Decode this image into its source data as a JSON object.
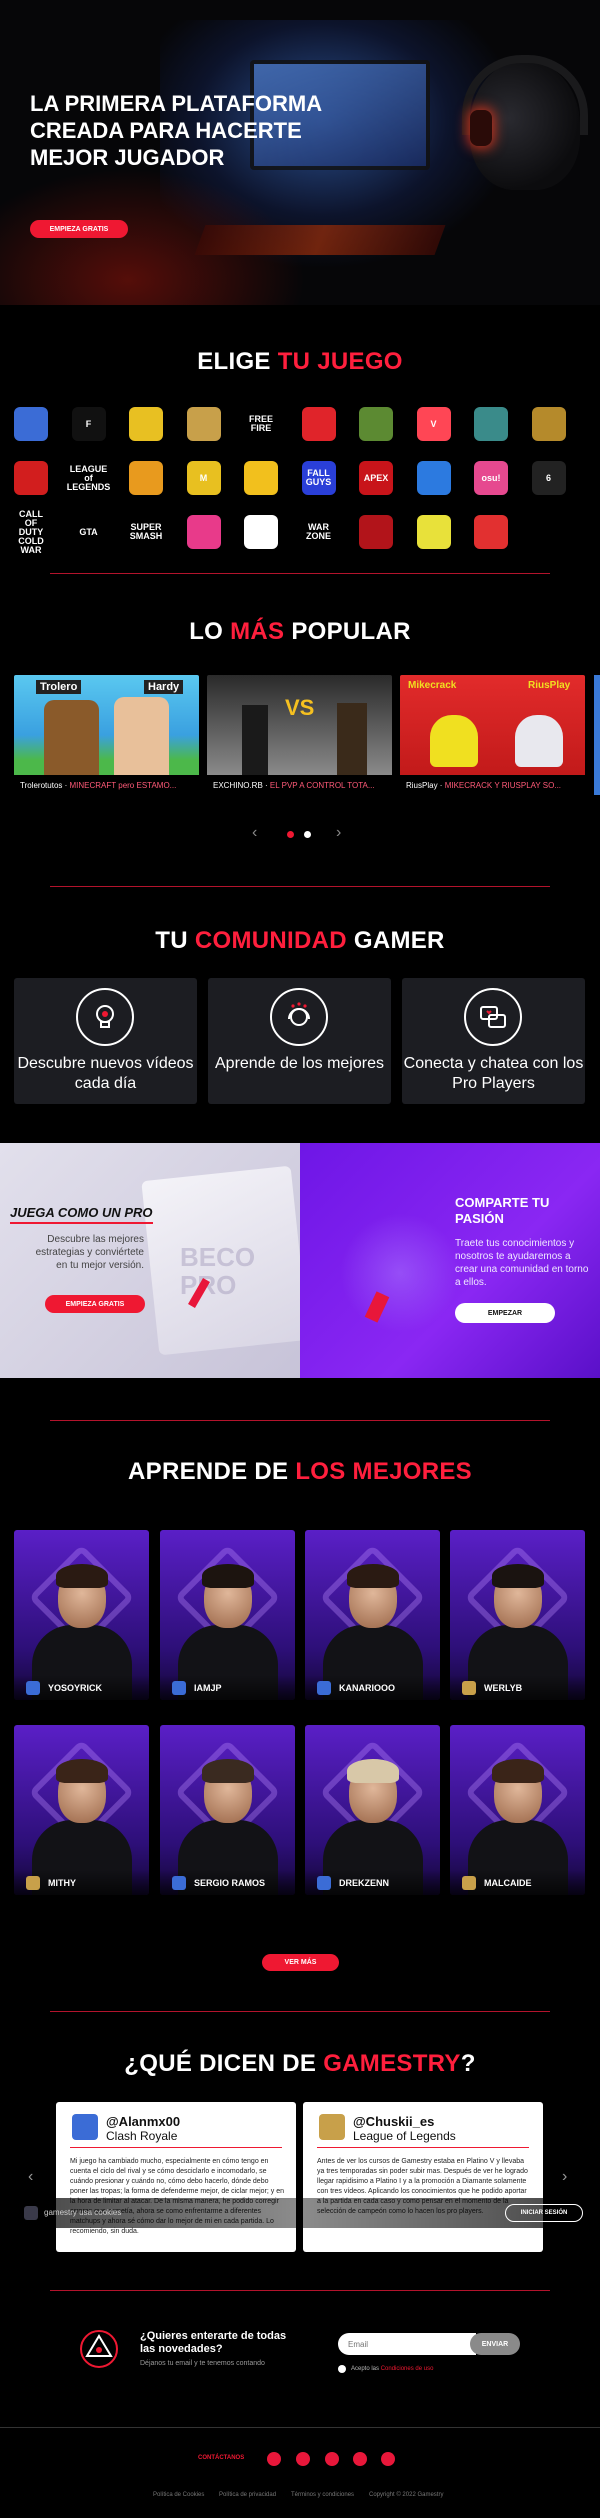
{
  "hero": {
    "title": "LA PRIMERA PLATAFORMA CREADA PARA HACERTE MEJOR JUGADOR",
    "cta": "EMPIEZA GRATIS"
  },
  "games": {
    "title_white": "ELIGE",
    "title_red": "TU JUEGO",
    "items": [
      {
        "name": "clash-royale",
        "label": "",
        "color": "#3b6cd6"
      },
      {
        "name": "fortnite",
        "label": "F",
        "color": "#111"
      },
      {
        "name": "brawl-stars",
        "label": "",
        "color": "#e8c022"
      },
      {
        "name": "league-of-legends",
        "label": "",
        "color": "#c8a04a"
      },
      {
        "name": "free-fire",
        "label": "FREE FIRE",
        "color": ""
      },
      {
        "name": "roblox",
        "label": "",
        "color": "#e0242a"
      },
      {
        "name": "minecraft",
        "label": "",
        "color": "#5c8a32"
      },
      {
        "name": "valorant",
        "label": "V",
        "color": "#ff4655"
      },
      {
        "name": "tft",
        "label": "",
        "color": "#3a8b8a"
      },
      {
        "name": "hearthstone",
        "label": "",
        "color": "#b58a2b"
      },
      {
        "name": "among-us",
        "label": "",
        "color": "#d21e1e"
      },
      {
        "name": "league-of-legends-wild-rift",
        "label": "LEAGUE of LEGENDS",
        "color": ""
      },
      {
        "name": "counter-strike",
        "label": "",
        "color": "#e89a1e"
      },
      {
        "name": "mobile-legends",
        "label": "M",
        "color": "#e8c020"
      },
      {
        "name": "tft-mobile",
        "label": "",
        "color": "#f2c01d"
      },
      {
        "name": "fall-guys",
        "label": "FALL GUYS",
        "color": "#2a3fd8"
      },
      {
        "name": "apex-legends",
        "label": "APEX",
        "color": "#c8141a"
      },
      {
        "name": "rocket-league",
        "label": "",
        "color": "#2c7ae0"
      },
      {
        "name": "osu",
        "label": "osu!",
        "color": "#e6498f"
      },
      {
        "name": "rainbow-six",
        "label": "6",
        "color": "#222"
      },
      {
        "name": "cod-cold-war",
        "label": "CALL OF DUTY COLD WAR",
        "color": ""
      },
      {
        "name": "gta",
        "label": "GTA",
        "color": ""
      },
      {
        "name": "super-smash",
        "label": "SUPER SMASH",
        "color": ""
      },
      {
        "name": "pokemon-unite",
        "label": "",
        "color": "#e83a8a"
      },
      {
        "name": "legends-runeterra",
        "label": "",
        "color": "#fff"
      },
      {
        "name": "warzone",
        "label": "WAR ZONE",
        "color": ""
      },
      {
        "name": "fifa",
        "label": "",
        "color": "#b2141a"
      },
      {
        "name": "cyberpunk",
        "label": "",
        "color": "#e8e13a"
      },
      {
        "name": "pokemon",
        "label": "",
        "color": "#e23030"
      }
    ]
  },
  "popular": {
    "title_white_1": "LO",
    "title_red": "MÁS",
    "title_white_2": "POPULAR",
    "videos": [
      {
        "channel": "Trolerotutos",
        "title": "MINECRAFT pero ESTAMO...",
        "thumb_text_1": "Trolero",
        "thumb_text_2": "Hardy"
      },
      {
        "channel": "EXCHINO.RB",
        "title": "EL PVP A CONTROL TOTA...",
        "thumb_text_1": "VS",
        "thumb_text_2": ""
      },
      {
        "channel": "RiusPlay",
        "title": "MIKECRACK Y RIUSPLAY SO...",
        "thumb_text_1": "Mikecrack",
        "thumb_text_2": "RiusPlay"
      }
    ]
  },
  "community": {
    "title_white_1": "TU",
    "title_red": "COMUNIDAD",
    "title_white_2": "GAMER",
    "cards": [
      {
        "text": "Descubre nuevos vídeos cada día",
        "icon": "lightbulb-gamepad-icon"
      },
      {
        "text": "Aprende de los mejores",
        "icon": "gamer-headset-icon"
      },
      {
        "text": "Conecta y chatea con los Pro Players",
        "icon": "chat-heart-icon"
      }
    ]
  },
  "pro_banner": {
    "title": "JUEGA COMO UN PRO",
    "text": "Descubre las mejores estrategias y conviértete en tu mejor versión.",
    "cta": "EMPIEZA GRATIS",
    "watermark": "BECO PRO"
  },
  "share_banner": {
    "title": "COMPARTE TU PASIÓN",
    "text": "Traete tus conocimientos y nosotros te ayudaremos a crear una comunidad en torno a ellos.",
    "cta": "EMPEZAR"
  },
  "pros": {
    "title_white": "APRENDE DE",
    "title_red": "LOS MEJORES",
    "players": [
      {
        "name": "YOSOYRICK",
        "game": "clash-royale",
        "hair": "#2a1a12"
      },
      {
        "name": "IAMJP",
        "game": "clash-royale",
        "hair": "#1c140f"
      },
      {
        "name": "KANARIOOO",
        "game": "clash-royale",
        "hair": "#2a1a12"
      },
      {
        "name": "WERLYB",
        "game": "league-of-legends",
        "hair": "#1a1310"
      },
      {
        "name": "MITHY",
        "game": "league-of-legends",
        "hair": "#3a2418"
      },
      {
        "name": "SERGIO RAMOS",
        "game": "clash-royale",
        "hair": "#3a2a20"
      },
      {
        "name": "DREKZENN",
        "game": "clash-royale",
        "hair": "#d8c8a8"
      },
      {
        "name": "MALCAIDE",
        "game": "league-of-legends",
        "hair": "#3a2418"
      }
    ],
    "cta": "VER MÁS"
  },
  "reviews": {
    "title_white_1": "¿QUÉ DICEN DE",
    "title_red": "GAMESTRY",
    "title_white_2": "?",
    "items": [
      {
        "user": "@Alanmx00",
        "game": "Clash Royale",
        "text": "Mi juego ha cambiado mucho, especialmente en cómo tengo en cuenta el ciclo del rival y se cómo desciclarlo e incomodarlo, se cuándo presionar y cuándo no, cómo debo hacerlo, dónde debo poner las tropas; la forma de defenderme mejor, de ciclar mejor; y en la hora de limitar al atacar. De la misma manera, he podido corregir errores que cometía, ahora se como enfrentarme a diferentes matchups y ahora sé cómo dar lo mejor de mi en cada partida. Lo recomiendo, sin duda."
      },
      {
        "user": "@Chuskii_es",
        "game": "League of Legends",
        "text": "Antes de ver los cursos de Gamestry estaba en Platino V y llevaba ya tres temporadas sin poder subir mas. Después de ver he logrado llegar rapidisimo a Platino I y a la promoción a Diamante solamente con tres vídeos. Aplicando los conocimientos que he podido aportar a la partida en cada caso y como pensar en el momento de la selección de campeón como lo hacen los pro players."
      }
    ],
    "cookie_text": "gamestry usa cookies",
    "login_btn": "INICIAR SESIÓN"
  },
  "newsletter": {
    "title": "¿Quieres enterarte de todas las novedades?",
    "subtitle": "Déjanos tu email y te tenemos contando",
    "email_placeholder": "Email",
    "submit": "ENVIAR",
    "accept_text": "Acepto las",
    "accept_link": "Condiciones de uso"
  },
  "footer": {
    "contact": "CONTÁCTANOS",
    "links": [
      "Política de Cookies",
      "Política de privacidad",
      "Términos y condiciones",
      "Copyright © 2022 Gamestry"
    ]
  },
  "colors": {
    "accent": "#ef1832",
    "purple": "#7a1ff0"
  }
}
